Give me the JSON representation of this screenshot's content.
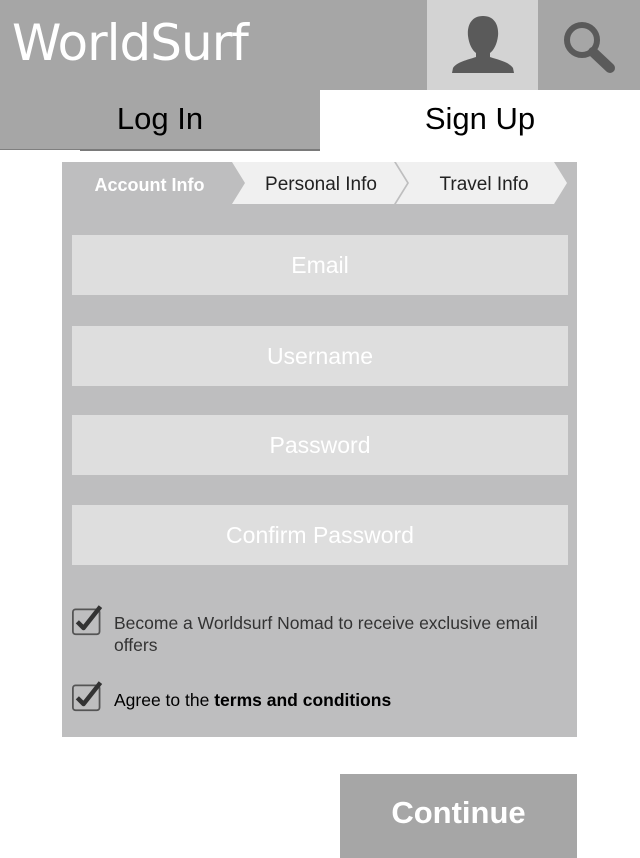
{
  "header": {
    "app_title": "WorldSurf",
    "profile_icon": "user-silhouette-icon",
    "search_icon": "magnifier-icon"
  },
  "auth_tabs": {
    "login_label": "Log In",
    "signup_label": "Sign Up",
    "active": "Sign Up"
  },
  "steps": [
    {
      "label": "Account Info",
      "active": true
    },
    {
      "label": "Personal Info",
      "active": false
    },
    {
      "label": "Travel Info",
      "active": false
    }
  ],
  "fields": {
    "email_placeholder": "Email",
    "username_placeholder": "Username",
    "password_placeholder": "Password",
    "confirm_password_placeholder": "Confirm Password"
  },
  "checkboxes": {
    "offers_label": "Become a Worldsurf Nomad to receive exclusive email offers",
    "offers_checked": true,
    "terms_prefix": "Agree to the ",
    "terms_link": "terms and conditions",
    "terms_checked": true
  },
  "continue_label": "Continue",
  "colors": {
    "header_bg": "#a6a6a6",
    "panel_bg": "#bebebf",
    "field_bg": "#dedede",
    "icon_dark": "#5a5a5a"
  }
}
